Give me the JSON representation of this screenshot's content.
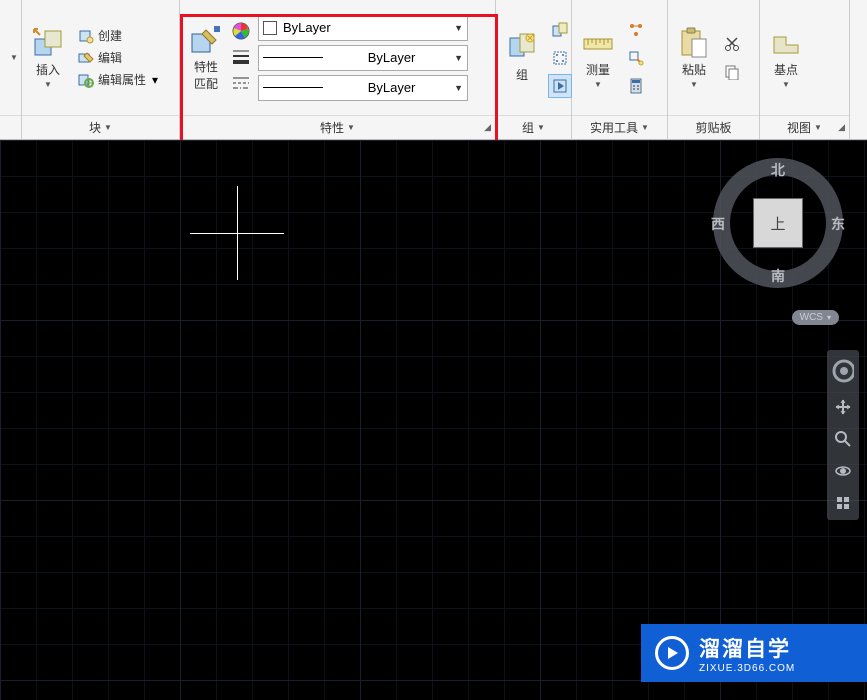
{
  "panels": {
    "block": {
      "label": "块",
      "insert": "插入",
      "create": "创建",
      "edit": "编辑",
      "edit_attr": "编辑属性"
    },
    "properties": {
      "label": "特性",
      "match": "特性\n匹配",
      "color": "ByLayer",
      "lineweight": "ByLayer",
      "linetype": "ByLayer"
    },
    "group": {
      "label": "组",
      "btn": "组"
    },
    "utilities": {
      "label": "实用工具",
      "btn": "测量"
    },
    "clipboard": {
      "label": "剪贴板",
      "btn": "粘贴"
    },
    "view": {
      "label": "视图",
      "btn": "基点"
    }
  },
  "viewcube": {
    "n": "北",
    "s": "南",
    "e": "东",
    "w": "西",
    "top": "上",
    "wcs": "WCS"
  },
  "watermark": {
    "line1": "溜溜自学",
    "line2": "ZIXUE.3D66.COM"
  }
}
